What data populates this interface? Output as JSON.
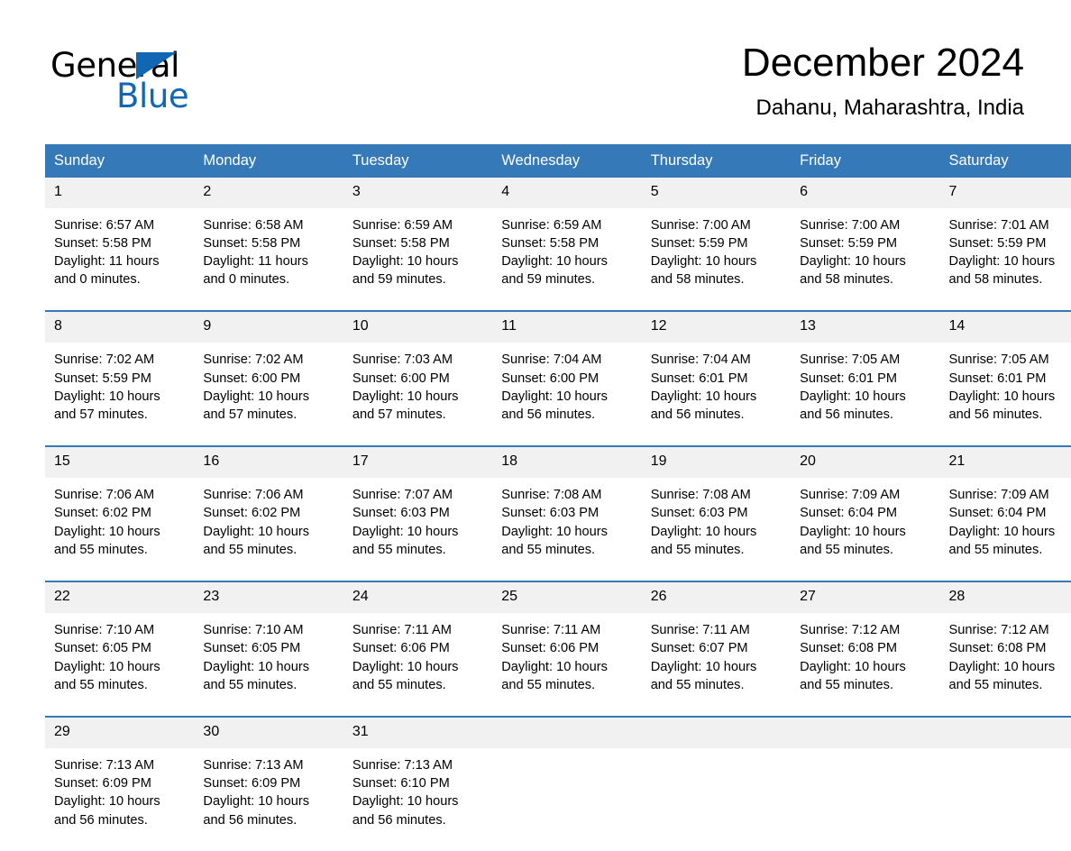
{
  "logo": {
    "text_primary": "General",
    "text_secondary": "Blue",
    "triangle_color": "#1267b2",
    "secondary_color": "#1267b2"
  },
  "header": {
    "title": "December 2024",
    "subtitle": "Dahanu, Maharashtra, India"
  },
  "theme": {
    "header_bg": "#3579b9",
    "header_text": "#ffffff",
    "daynum_bg": "#f1f1f1",
    "separator": "#3579b9",
    "page_bg": "#ffffff",
    "body_text": "#000000"
  },
  "weekday_headers": [
    "Sunday",
    "Monday",
    "Tuesday",
    "Wednesday",
    "Thursday",
    "Friday",
    "Saturday"
  ],
  "weeks": [
    [
      {
        "day": "1",
        "sunrise": "Sunrise: 6:57 AM",
        "sunset": "Sunset: 5:58 PM",
        "daylight_1": "Daylight: 11 hours",
        "daylight_2": "and 0 minutes."
      },
      {
        "day": "2",
        "sunrise": "Sunrise: 6:58 AM",
        "sunset": "Sunset: 5:58 PM",
        "daylight_1": "Daylight: 11 hours",
        "daylight_2": "and 0 minutes."
      },
      {
        "day": "3",
        "sunrise": "Sunrise: 6:59 AM",
        "sunset": "Sunset: 5:58 PM",
        "daylight_1": "Daylight: 10 hours",
        "daylight_2": "and 59 minutes."
      },
      {
        "day": "4",
        "sunrise": "Sunrise: 6:59 AM",
        "sunset": "Sunset: 5:58 PM",
        "daylight_1": "Daylight: 10 hours",
        "daylight_2": "and 59 minutes."
      },
      {
        "day": "5",
        "sunrise": "Sunrise: 7:00 AM",
        "sunset": "Sunset: 5:59 PM",
        "daylight_1": "Daylight: 10 hours",
        "daylight_2": "and 58 minutes."
      },
      {
        "day": "6",
        "sunrise": "Sunrise: 7:00 AM",
        "sunset": "Sunset: 5:59 PM",
        "daylight_1": "Daylight: 10 hours",
        "daylight_2": "and 58 minutes."
      },
      {
        "day": "7",
        "sunrise": "Sunrise: 7:01 AM",
        "sunset": "Sunset: 5:59 PM",
        "daylight_1": "Daylight: 10 hours",
        "daylight_2": "and 58 minutes."
      }
    ],
    [
      {
        "day": "8",
        "sunrise": "Sunrise: 7:02 AM",
        "sunset": "Sunset: 5:59 PM",
        "daylight_1": "Daylight: 10 hours",
        "daylight_2": "and 57 minutes."
      },
      {
        "day": "9",
        "sunrise": "Sunrise: 7:02 AM",
        "sunset": "Sunset: 6:00 PM",
        "daylight_1": "Daylight: 10 hours",
        "daylight_2": "and 57 minutes."
      },
      {
        "day": "10",
        "sunrise": "Sunrise: 7:03 AM",
        "sunset": "Sunset: 6:00 PM",
        "daylight_1": "Daylight: 10 hours",
        "daylight_2": "and 57 minutes."
      },
      {
        "day": "11",
        "sunrise": "Sunrise: 7:04 AM",
        "sunset": "Sunset: 6:00 PM",
        "daylight_1": "Daylight: 10 hours",
        "daylight_2": "and 56 minutes."
      },
      {
        "day": "12",
        "sunrise": "Sunrise: 7:04 AM",
        "sunset": "Sunset: 6:01 PM",
        "daylight_1": "Daylight: 10 hours",
        "daylight_2": "and 56 minutes."
      },
      {
        "day": "13",
        "sunrise": "Sunrise: 7:05 AM",
        "sunset": "Sunset: 6:01 PM",
        "daylight_1": "Daylight: 10 hours",
        "daylight_2": "and 56 minutes."
      },
      {
        "day": "14",
        "sunrise": "Sunrise: 7:05 AM",
        "sunset": "Sunset: 6:01 PM",
        "daylight_1": "Daylight: 10 hours",
        "daylight_2": "and 56 minutes."
      }
    ],
    [
      {
        "day": "15",
        "sunrise": "Sunrise: 7:06 AM",
        "sunset": "Sunset: 6:02 PM",
        "daylight_1": "Daylight: 10 hours",
        "daylight_2": "and 55 minutes."
      },
      {
        "day": "16",
        "sunrise": "Sunrise: 7:06 AM",
        "sunset": "Sunset: 6:02 PM",
        "daylight_1": "Daylight: 10 hours",
        "daylight_2": "and 55 minutes."
      },
      {
        "day": "17",
        "sunrise": "Sunrise: 7:07 AM",
        "sunset": "Sunset: 6:03 PM",
        "daylight_1": "Daylight: 10 hours",
        "daylight_2": "and 55 minutes."
      },
      {
        "day": "18",
        "sunrise": "Sunrise: 7:08 AM",
        "sunset": "Sunset: 6:03 PM",
        "daylight_1": "Daylight: 10 hours",
        "daylight_2": "and 55 minutes."
      },
      {
        "day": "19",
        "sunrise": "Sunrise: 7:08 AM",
        "sunset": "Sunset: 6:03 PM",
        "daylight_1": "Daylight: 10 hours",
        "daylight_2": "and 55 minutes."
      },
      {
        "day": "20",
        "sunrise": "Sunrise: 7:09 AM",
        "sunset": "Sunset: 6:04 PM",
        "daylight_1": "Daylight: 10 hours",
        "daylight_2": "and 55 minutes."
      },
      {
        "day": "21",
        "sunrise": "Sunrise: 7:09 AM",
        "sunset": "Sunset: 6:04 PM",
        "daylight_1": "Daylight: 10 hours",
        "daylight_2": "and 55 minutes."
      }
    ],
    [
      {
        "day": "22",
        "sunrise": "Sunrise: 7:10 AM",
        "sunset": "Sunset: 6:05 PM",
        "daylight_1": "Daylight: 10 hours",
        "daylight_2": "and 55 minutes."
      },
      {
        "day": "23",
        "sunrise": "Sunrise: 7:10 AM",
        "sunset": "Sunset: 6:05 PM",
        "daylight_1": "Daylight: 10 hours",
        "daylight_2": "and 55 minutes."
      },
      {
        "day": "24",
        "sunrise": "Sunrise: 7:11 AM",
        "sunset": "Sunset: 6:06 PM",
        "daylight_1": "Daylight: 10 hours",
        "daylight_2": "and 55 minutes."
      },
      {
        "day": "25",
        "sunrise": "Sunrise: 7:11 AM",
        "sunset": "Sunset: 6:06 PM",
        "daylight_1": "Daylight: 10 hours",
        "daylight_2": "and 55 minutes."
      },
      {
        "day": "26",
        "sunrise": "Sunrise: 7:11 AM",
        "sunset": "Sunset: 6:07 PM",
        "daylight_1": "Daylight: 10 hours",
        "daylight_2": "and 55 minutes."
      },
      {
        "day": "27",
        "sunrise": "Sunrise: 7:12 AM",
        "sunset": "Sunset: 6:08 PM",
        "daylight_1": "Daylight: 10 hours",
        "daylight_2": "and 55 minutes."
      },
      {
        "day": "28",
        "sunrise": "Sunrise: 7:12 AM",
        "sunset": "Sunset: 6:08 PM",
        "daylight_1": "Daylight: 10 hours",
        "daylight_2": "and 55 minutes."
      }
    ],
    [
      {
        "day": "29",
        "sunrise": "Sunrise: 7:13 AM",
        "sunset": "Sunset: 6:09 PM",
        "daylight_1": "Daylight: 10 hours",
        "daylight_2": "and 56 minutes."
      },
      {
        "day": "30",
        "sunrise": "Sunrise: 7:13 AM",
        "sunset": "Sunset: 6:09 PM",
        "daylight_1": "Daylight: 10 hours",
        "daylight_2": "and 56 minutes."
      },
      {
        "day": "31",
        "sunrise": "Sunrise: 7:13 AM",
        "sunset": "Sunset: 6:10 PM",
        "daylight_1": "Daylight: 10 hours",
        "daylight_2": "and 56 minutes."
      },
      {
        "day": "",
        "sunrise": "",
        "sunset": "",
        "daylight_1": "",
        "daylight_2": ""
      },
      {
        "day": "",
        "sunrise": "",
        "sunset": "",
        "daylight_1": "",
        "daylight_2": ""
      },
      {
        "day": "",
        "sunrise": "",
        "sunset": "",
        "daylight_1": "",
        "daylight_2": ""
      },
      {
        "day": "",
        "sunrise": "",
        "sunset": "",
        "daylight_1": "",
        "daylight_2": ""
      }
    ]
  ]
}
